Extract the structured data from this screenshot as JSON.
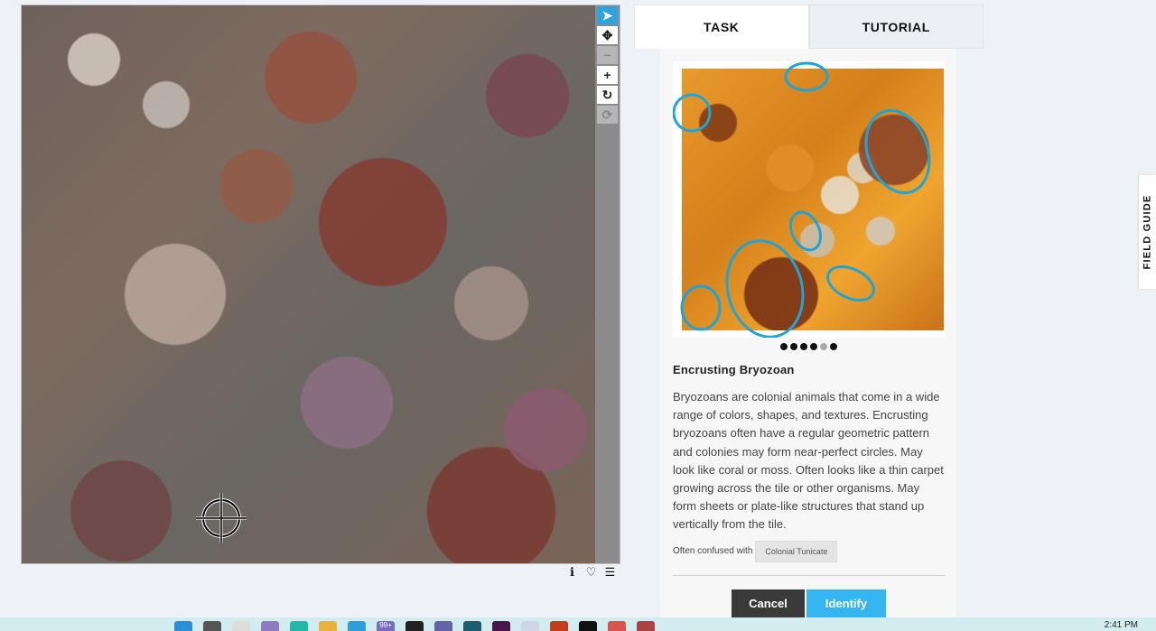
{
  "viewer": {
    "tools": [
      {
        "name": "pointer-tool",
        "icon": "arrow-cursor-icon",
        "glyph": "➤",
        "state": "active"
      },
      {
        "name": "move-tool",
        "icon": "move-arrows-icon",
        "glyph": "✥",
        "state": "normal"
      },
      {
        "name": "zoom-out-tool",
        "icon": "minus-icon",
        "glyph": "−",
        "state": "disabled"
      },
      {
        "name": "zoom-in-tool",
        "icon": "plus-icon",
        "glyph": "+",
        "state": "normal"
      },
      {
        "name": "rotate-tool",
        "icon": "rotate-icon",
        "glyph": "↻",
        "state": "normal"
      },
      {
        "name": "reset-tool",
        "icon": "refresh-icon",
        "glyph": "⟳",
        "state": "disabled"
      }
    ],
    "meta_icons": [
      {
        "name": "info-icon",
        "glyph": "ℹ"
      },
      {
        "name": "heart-icon",
        "glyph": "♡"
      },
      {
        "name": "list-icon",
        "glyph": "☰"
      }
    ]
  },
  "panel": {
    "tabs": {
      "task": "TASK",
      "tutorial": "TUTORIAL"
    },
    "example_dots": [
      true,
      true,
      true,
      true,
      false,
      true
    ],
    "species_title": "Encrusting Bryozoan",
    "description": "Bryozoans are colonial animals that come in a wide range of colors, shapes, and textures. Encrusting bryozoans often have a regular geometric pattern and colonies may form near-perfect circles. May look like coral or moss. Often looks like a thin carpet growing across the tile or other organisms. May form sheets or plate-like structures that stand up vertically from the tile.",
    "confused_label": "Often confused with",
    "confused_with": "Colonial Tunicate",
    "cancel_label": "Cancel",
    "identify_label": "Identify"
  },
  "field_guide_label": "FIELD GUIDE",
  "taskbar": {
    "badge": "99+",
    "clock": "2:41 PM"
  },
  "colors": {
    "accent": "#35b6f2",
    "active_tool": "#2fa3e0",
    "cancel": "#3a3a3a",
    "ellipse": "#1ea4d6"
  }
}
